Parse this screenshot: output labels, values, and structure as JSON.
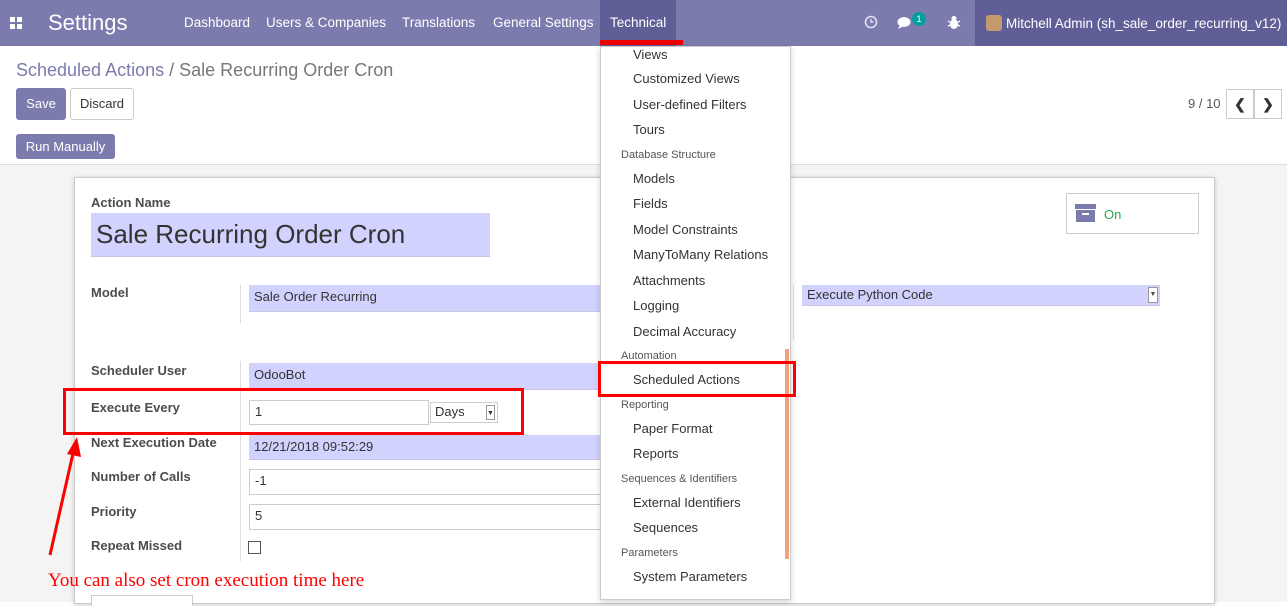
{
  "navbar": {
    "brand": "Settings",
    "menu": [
      "Dashboard",
      "Users & Companies",
      "Translations",
      "General Settings",
      "Technical"
    ],
    "active_menu": "Technical",
    "chat_badge": "1",
    "user": "Mitchell Admin (sh_sale_order_recurring_v12)",
    "icons": [
      "apps-icon",
      "clock-icon",
      "chat-icon",
      "bug-icon"
    ]
  },
  "control_panel": {
    "breadcrumb_parent": "Scheduled Actions",
    "breadcrumb_sep": "/",
    "breadcrumb_current": "Sale Recurring Order Cron",
    "save_label": "Save",
    "discard_label": "Discard",
    "pager": "9 / 10",
    "prev": "❮",
    "next": "❯"
  },
  "statusbar": {
    "run_manually": "Run Manually"
  },
  "form": {
    "action_name_label": "Action Name",
    "action_name": "Sale Recurring Order Cron",
    "active_toggle": "On",
    "model_label": "Model",
    "model_value": "Sale Order Recurring",
    "action_type_value": "Execute Python Code",
    "scheduler_user_label": "Scheduler User",
    "scheduler_user_value": "OdooBot",
    "execute_every_label": "Execute Every",
    "interval_number": "1",
    "interval_type": "Days",
    "next_exec_label": "Next Execution Date",
    "next_exec_value": "12/21/2018 09:52:29",
    "number_of_calls_label": "Number of Calls",
    "number_of_calls_value": "-1",
    "priority_label": "Priority",
    "priority_value": "5",
    "repeat_missed_label": "Repeat Missed",
    "repeat_missed": false
  },
  "technical_menu": {
    "items": [
      {
        "type": "item",
        "label": "Views"
      },
      {
        "type": "item",
        "label": "Customized Views"
      },
      {
        "type": "item",
        "label": "User-defined Filters"
      },
      {
        "type": "item",
        "label": "Tours"
      },
      {
        "type": "header",
        "label": "Database Structure"
      },
      {
        "type": "item",
        "label": "Models"
      },
      {
        "type": "item",
        "label": "Fields"
      },
      {
        "type": "item",
        "label": "Model Constraints"
      },
      {
        "type": "item",
        "label": "ManyToMany Relations"
      },
      {
        "type": "item",
        "label": "Attachments"
      },
      {
        "type": "item",
        "label": "Logging"
      },
      {
        "type": "item",
        "label": "Decimal Accuracy"
      },
      {
        "type": "header",
        "label": "Automation"
      },
      {
        "type": "item",
        "label": "Scheduled Actions"
      },
      {
        "type": "header",
        "label": "Reporting"
      },
      {
        "type": "item",
        "label": "Paper Format"
      },
      {
        "type": "item",
        "label": "Reports"
      },
      {
        "type": "header",
        "label": "Sequences & Identifiers"
      },
      {
        "type": "item",
        "label": "External Identifiers"
      },
      {
        "type": "item",
        "label": "Sequences"
      },
      {
        "type": "header",
        "label": "Parameters"
      },
      {
        "type": "item",
        "label": "System Parameters"
      }
    ]
  },
  "annotation": "You can also set cron execution time here",
  "colors": {
    "navbar": "#7c7bad",
    "highlight": "#ff0000",
    "field_bg": "#d2d2ff"
  }
}
